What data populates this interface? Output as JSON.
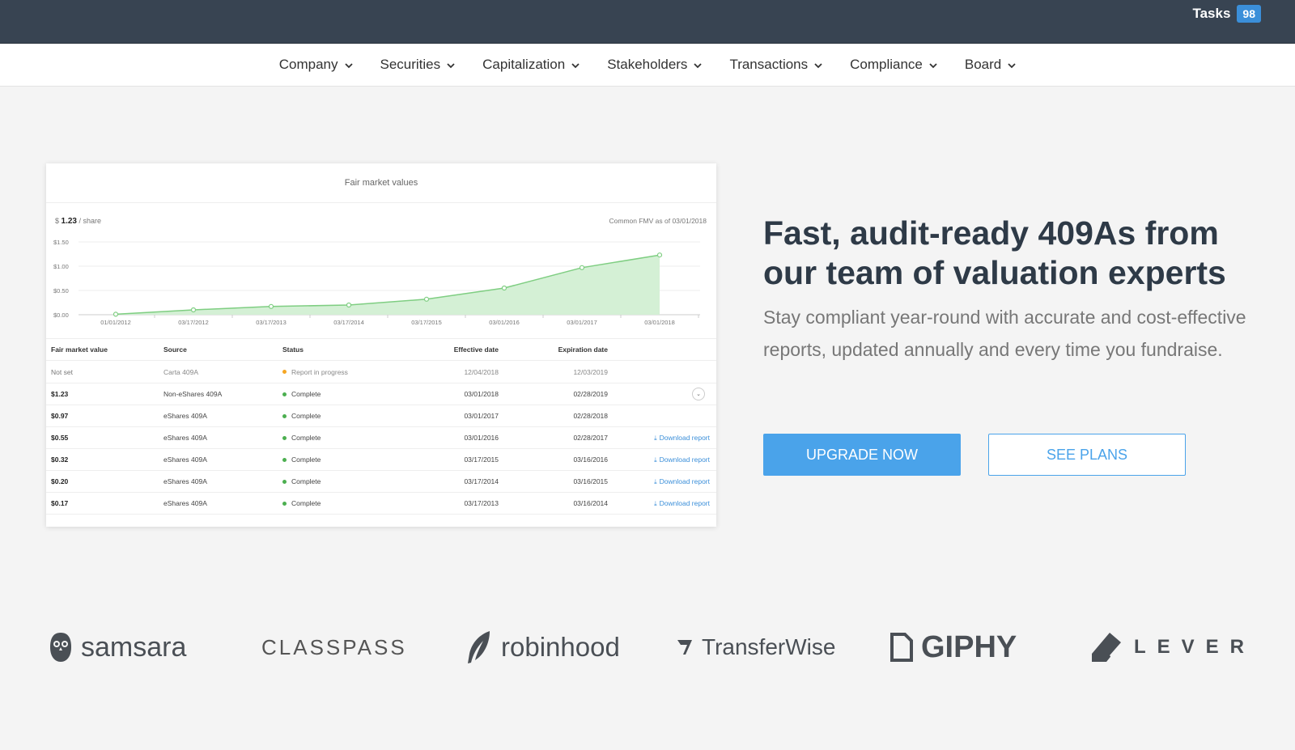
{
  "topbar": {
    "tasks_label": "Tasks",
    "tasks_count": "98"
  },
  "nav": {
    "items": [
      {
        "label": "Company"
      },
      {
        "label": "Securities"
      },
      {
        "label": "Capitalization"
      },
      {
        "label": "Stakeholders"
      },
      {
        "label": "Transactions"
      },
      {
        "label": "Compliance"
      },
      {
        "label": "Board"
      }
    ]
  },
  "card": {
    "title": "Fair market values",
    "price_prefix": "$",
    "price_value": "1.23",
    "price_suffix": "/ share",
    "fmv_note": "Common FMV as of 03/01/2018"
  },
  "chart_data": {
    "type": "area",
    "x": [
      "01/01/2012",
      "03/17/2012",
      "03/17/2013",
      "03/17/2014",
      "03/17/2015",
      "03/01/2016",
      "03/01/2017",
      "03/01/2018"
    ],
    "values": [
      0.01,
      0.1,
      0.17,
      0.2,
      0.32,
      0.55,
      0.97,
      1.23
    ],
    "y_ticks": [
      "$0.00",
      "$0.50",
      "$1.00",
      "$1.50"
    ],
    "ylim": [
      0,
      1.5
    ],
    "color": "#7fce82",
    "fill": "#d4f0d5",
    "grid": true
  },
  "table": {
    "headers": [
      "Fair market value",
      "Source",
      "Status",
      "Effective date",
      "Expiration date"
    ],
    "rows": [
      {
        "fmv": "Not set",
        "source": "Carta 409A",
        "status": "Report in progress",
        "status_color": "orange",
        "effective": "12/04/2018",
        "expiration": "12/03/2019",
        "action": ""
      },
      {
        "fmv": "$1.23",
        "source": "Non-eShares 409A",
        "status": "Complete",
        "status_color": "green",
        "effective": "03/01/2018",
        "expiration": "02/28/2019",
        "action": ""
      },
      {
        "fmv": "$0.97",
        "source": "eShares 409A",
        "status": "Complete",
        "status_color": "green",
        "effective": "03/01/2017",
        "expiration": "02/28/2018",
        "action": ""
      },
      {
        "fmv": "$0.55",
        "source": "eShares 409A",
        "status": "Complete",
        "status_color": "green",
        "effective": "03/01/2016",
        "expiration": "02/28/2017",
        "action": "Download report"
      },
      {
        "fmv": "$0.32",
        "source": "eShares 409A",
        "status": "Complete",
        "status_color": "green",
        "effective": "03/17/2015",
        "expiration": "03/16/2016",
        "action": "Download report"
      },
      {
        "fmv": "$0.20",
        "source": "eShares 409A",
        "status": "Complete",
        "status_color": "green",
        "effective": "03/17/2014",
        "expiration": "03/16/2015",
        "action": "Download report"
      },
      {
        "fmv": "$0.17",
        "source": "eShares 409A",
        "status": "Complete",
        "status_color": "green",
        "effective": "03/17/2013",
        "expiration": "03/16/2014",
        "action": "Download report"
      }
    ]
  },
  "hero": {
    "title": "Fast, audit-ready 409As from our team of valuation experts",
    "subtitle": "Stay compliant year-round with accurate and cost-effective reports, updated annually and every time you fundraise.",
    "primary_button": "UPGRADE NOW",
    "secondary_button": "SEE PLANS"
  },
  "logos": {
    "samsara": "samsara",
    "classpass": "CLASSPASS",
    "robinhood": "robinhood",
    "transferwise": "TransferWise",
    "giphy": "GIPHY",
    "lever": "LEVER"
  }
}
